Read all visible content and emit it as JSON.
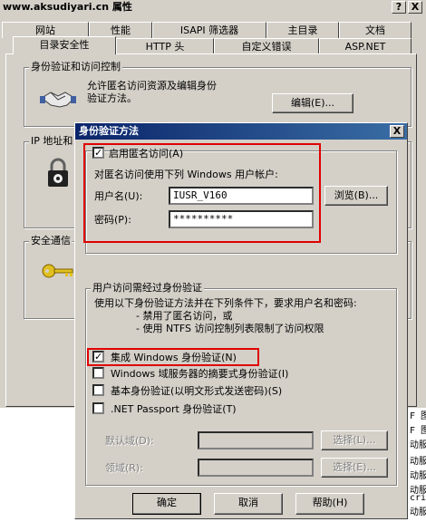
{
  "back_window": {
    "title": "www.aksudiyari.cn 属性",
    "help_button": "?",
    "close_button": "X",
    "tabs_row1": [
      "网站",
      "性能",
      "ISAPI 筛选器",
      "主目录",
      "文档"
    ],
    "tabs_row2": [
      "目录安全性",
      "HTTP 头",
      "自定义错误",
      "ASP.NET"
    ],
    "auth_group_title": "身份验证和访问控制",
    "auth_description": "允许匿名访问资源及编辑身份验证方法。",
    "edit_button": "编辑(E)...",
    "ip_group_title": "IP 地址和",
    "secure_group_title": "安全通信",
    "side_items": [
      "F 图",
      "F 图",
      "动服",
      "动服",
      "动服",
      "动服",
      "crij",
      "动服"
    ]
  },
  "dialog": {
    "title": "身份验证方法",
    "close_button": "X",
    "anonymous": {
      "checkbox_label": "启用匿名访问(A)",
      "checked": true,
      "description": "对匿名访问使用下列 Windows 用户帐户:",
      "username_label": "用户名(U):",
      "username_value": "IUSR_V160",
      "password_label": "密码(P):",
      "password_value": "**********",
      "browse_button": "浏览(B)..."
    },
    "auth_group": {
      "title": "用户访问需经过身份验证",
      "description_lines": [
        "使用以下身份验证方法并在下列条件下，要求用户名和密码:",
        "- 禁用了匿名访问，或",
        "- 使用 NTFS 访问控制列表限制了访问权限"
      ],
      "options": [
        {
          "label": "集成 Windows 身份验证(N)",
          "checked": true
        },
        {
          "label": "Windows 域服务器的摘要式身份验证(I)",
          "checked": false
        },
        {
          "label": "基本身份验证(以明文形式发送密码)(S)",
          "checked": false
        },
        {
          "label": ".NET Passport 身份验证(T)",
          "checked": false
        }
      ],
      "default_domain_label": "默认域(D):",
      "realm_label": "领域(R):",
      "select_button": "选择(L)...",
      "select_button2": "选择(E)..."
    },
    "ok_button": "确定",
    "cancel_button": "取消",
    "help_button": "帮助(H)",
    "check_mark": "✓"
  }
}
